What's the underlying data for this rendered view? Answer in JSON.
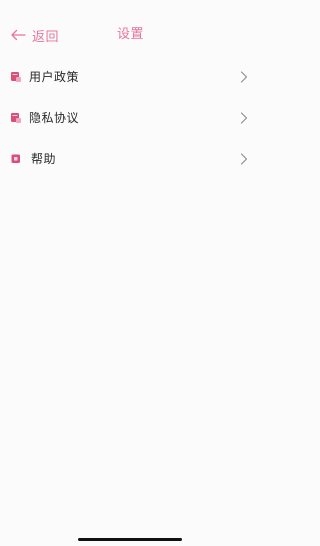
{
  "header": {
    "back_label": "返回",
    "title": "设置"
  },
  "menu": {
    "items": [
      {
        "label": "用户政策",
        "icon": "document-icon"
      },
      {
        "label": "隐私协议",
        "icon": "document-icon"
      },
      {
        "label": "帮助",
        "icon": "help-icon"
      }
    ]
  },
  "colors": {
    "accent": "#e8759b",
    "icon": "#d94f77",
    "chevron": "#8a8a8a"
  }
}
